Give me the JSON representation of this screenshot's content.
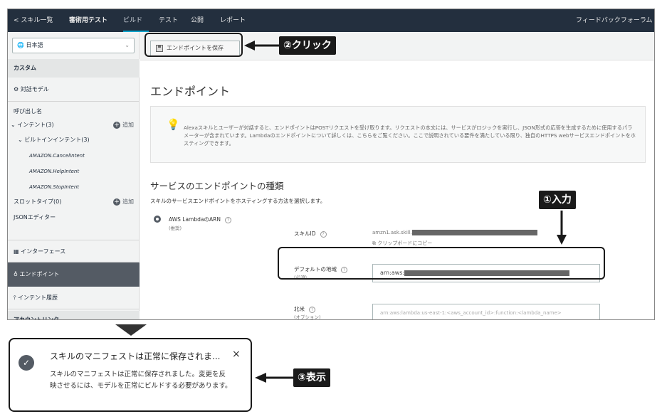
{
  "topbar": {
    "back": "< スキル一覧",
    "tabs": [
      "審術用テスト",
      "ビルド",
      "テスト",
      "公開",
      "レポート"
    ],
    "feedback": "フィードバックフォーラム"
  },
  "sidebar": {
    "language": "日本語",
    "custom_header": "カスタム",
    "interaction_model": "対話モデル",
    "invocation_name": "呼び出し名",
    "intents": "インテント(3)",
    "add_label": "追加",
    "builtin_intents": "ビルトインインテント(3)",
    "amazon_intents": [
      "AMAZON.CancelIntent",
      "AMAZON.HelpIntent",
      "AMAZON.StopIntent"
    ],
    "slot_types": "スロットタイプ(0)",
    "json_editor": "JSONエディター",
    "interfaces": "インターフェース",
    "endpoint": "エンドポイント",
    "intent_history": "インテント履歴",
    "account_linking": "アカウントリンク"
  },
  "main": {
    "save_button": "エンドポイントを保存",
    "title": "エンドポイント",
    "info": "Alexaスキルとユーザーが対話すると、エンドポイントはPOSTリクエストを受け取ります。リクエストの本文には、サービスがロジックを実行し、JSON形式の応答を生成するために使用するパラメーターが含まれています。Lambdaのエンドポイントについて詳しくは、こちらをご覧ください。ここで説明されている要件を満たしている限り、独自のHTTPS webサービスエンドポイントをホスティングできます。",
    "service_title": "サービスのエンドポイントの種類",
    "service_sub": "スキルのサービスエンドポイントをホスティングする方法を選択します。",
    "radio_label": "AWS LambdaのARN",
    "radio_sub": "(推奨)",
    "skill_id_label": "スキルID",
    "skill_id_value": "amzn1.ask.skill.",
    "copy_clipboard": "クリップボードにコピー",
    "default_region_label": "デフォルトの地域",
    "default_region_sub": "(必須)",
    "default_region_value": "arn:aws:",
    "na_label": "北米",
    "na_sub": "(オプション)",
    "na_placeholder": "arn:aws:lambda:us-east-1:<aws_account_id>:function:<lambda_name>"
  },
  "callouts": {
    "click": "②クリック",
    "input": "①入力",
    "display": "③表示"
  },
  "toast": {
    "title": "スキルのマニフェストは正常に保存されま...",
    "close": "×",
    "body": "スキルのマニフェストは正常に保存されました。変更を反映させるには、モデルを正常にビルドする必要があります。"
  },
  "icons": [
    "globe-icon",
    "chevron-down-icon",
    "gear-icon",
    "save-icon",
    "bulb-icon",
    "help-icon",
    "copy-icon",
    "check-icon",
    "close-icon",
    "grid-icon",
    "history-icon",
    "plug-icon"
  ]
}
